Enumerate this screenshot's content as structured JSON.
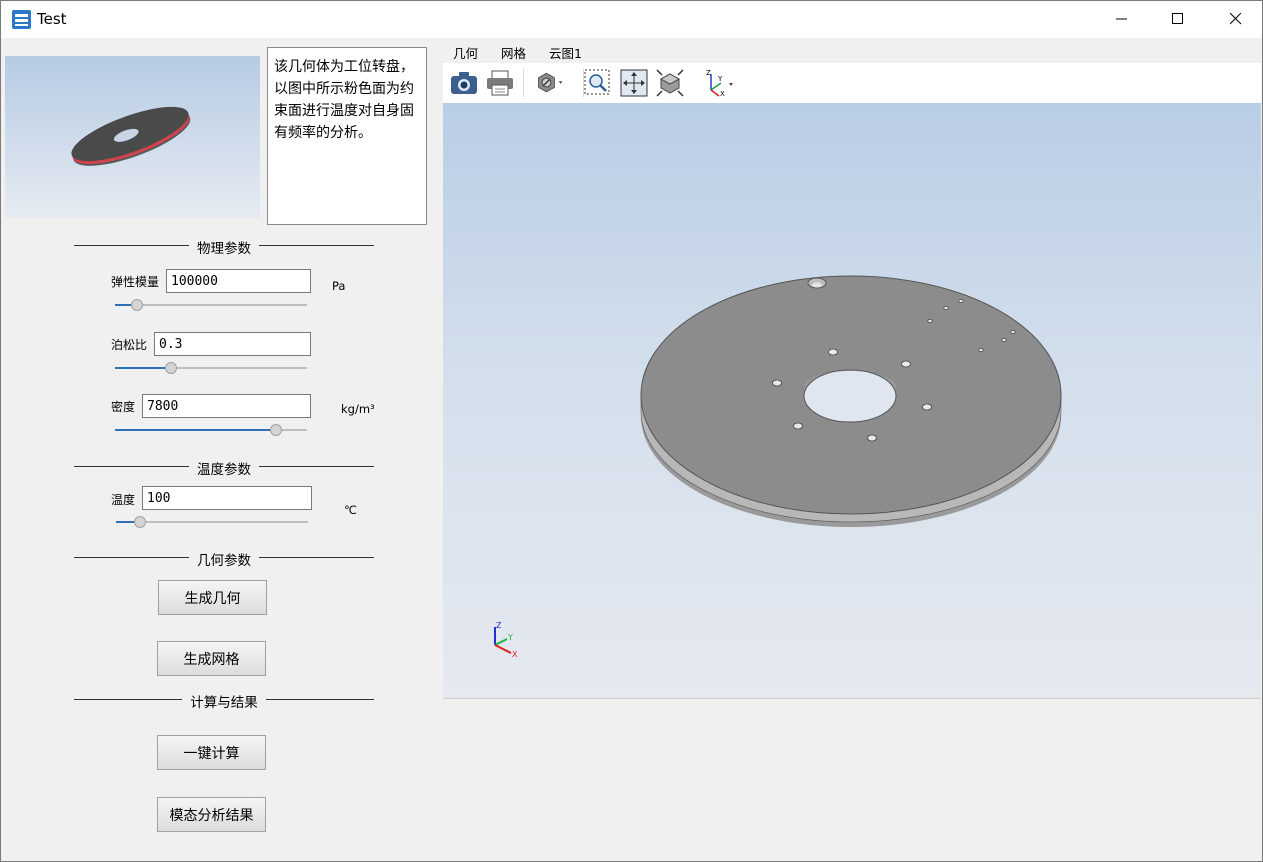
{
  "window": {
    "title": "Test"
  },
  "description": "该几何体为工位转盘，以图中所示粉色面为约束面进行温度对自身固有频率的分析。",
  "sections": {
    "physical": "物理参数",
    "temperature": "温度参数",
    "geometry": "几何参数",
    "results": "计算与结果"
  },
  "fields": {
    "elastic_modulus": {
      "label": "弹性模量",
      "value": "100000",
      "unit": "Pa",
      "slider_fraction": 0.09
    },
    "poisson_ratio": {
      "label": "泊松比",
      "value": "0.3",
      "unit": "",
      "slider_fraction": 0.28
    },
    "density": {
      "label": "密度",
      "value": "7800",
      "unit": "kg/m³",
      "slider_fraction": 0.86
    },
    "temperature": {
      "label": "温度",
      "value": "100",
      "unit": "℃",
      "slider_fraction": 0.1
    }
  },
  "buttons": {
    "gen_geometry": "生成几何",
    "gen_mesh": "生成网格",
    "compute": "一键计算",
    "modal_results": "模态分析结果"
  },
  "tabs": [
    "几何",
    "网格",
    "云图1"
  ],
  "axis_labels": {
    "z": "Z",
    "y": "Y",
    "x": "X"
  },
  "colors": {
    "accent": "#2f6fb7",
    "constraint_face": "#e8404a"
  }
}
